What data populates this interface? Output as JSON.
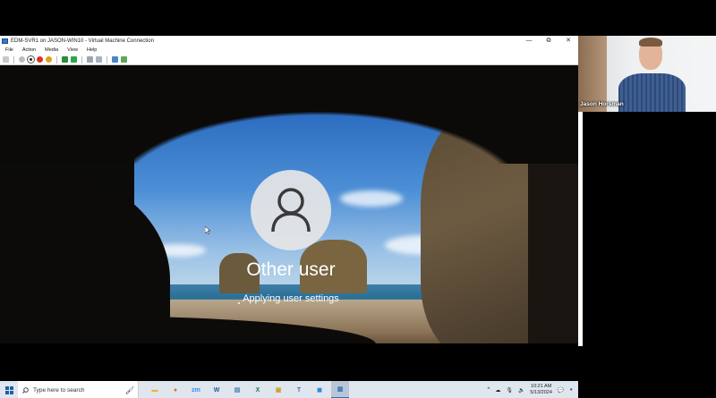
{
  "vm_window": {
    "title": "EDM-SVR1 on JASON-WIN10 - Virtual Machine Connection",
    "controls": {
      "minimize": "—",
      "maximize": "⧉",
      "close": "✕"
    },
    "menu": [
      "File",
      "Action",
      "Media",
      "View",
      "Help"
    ]
  },
  "login": {
    "user_name": "Other user",
    "status": "Applying user settings"
  },
  "taskbar": {
    "search_placeholder": "Type here to search",
    "apps": [
      {
        "name": "file-explorer",
        "glyph": "▬",
        "color": "#e8b634"
      },
      {
        "name": "firefox",
        "glyph": "●",
        "color": "#e66b20"
      },
      {
        "name": "zoom",
        "glyph": "zm",
        "color": "#2d8cff"
      },
      {
        "name": "word",
        "glyph": "W",
        "color": "#2b579a"
      },
      {
        "name": "notepad",
        "glyph": "▤",
        "color": "#4a7fb0"
      },
      {
        "name": "excel",
        "glyph": "X",
        "color": "#217346"
      },
      {
        "name": "app-yellow",
        "glyph": "▣",
        "color": "#c9a227"
      },
      {
        "name": "teams",
        "glyph": "T",
        "color": "#5b5fc7"
      },
      {
        "name": "app-blue",
        "glyph": "◼",
        "color": "#2e8bd6"
      },
      {
        "name": "hyper-v",
        "glyph": "▦",
        "color": "#3c78b8"
      }
    ],
    "clock": {
      "time": "10:21 AM",
      "date": "5/13/2024"
    }
  },
  "webcam": {
    "participant_name": "Jason Horsman"
  }
}
